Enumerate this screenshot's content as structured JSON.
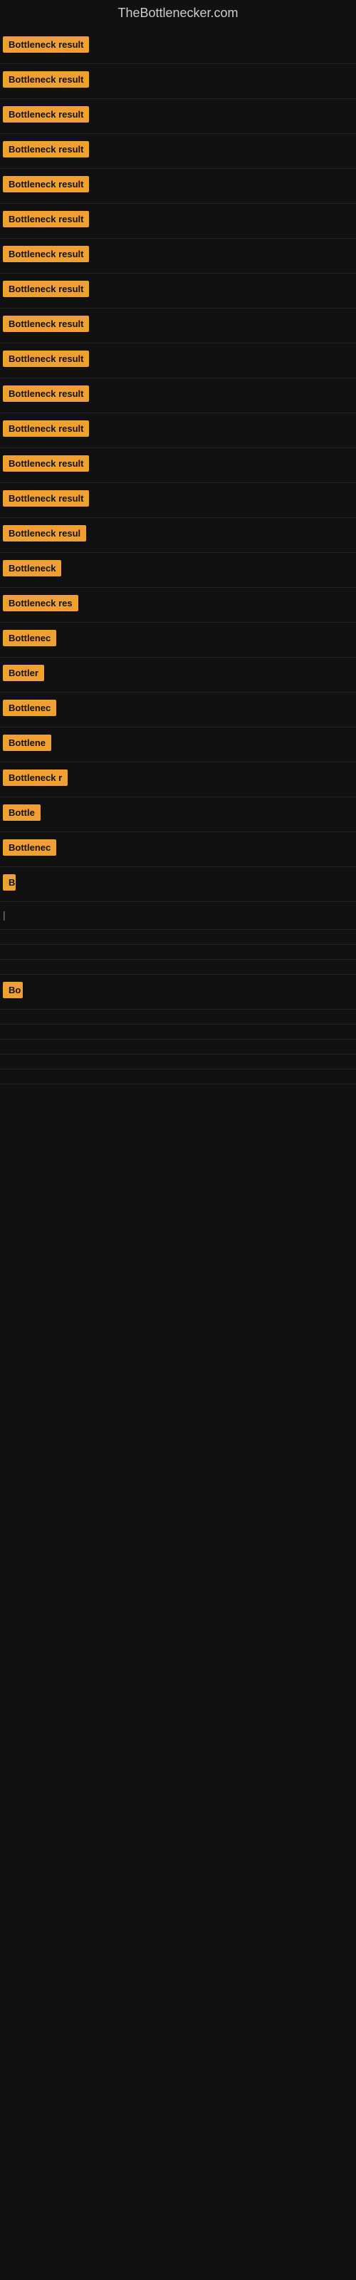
{
  "site": {
    "title": "TheBottlenecker.com"
  },
  "rows": [
    {
      "label": "Bottleneck result",
      "width": 170
    },
    {
      "label": "Bottleneck result",
      "width": 170
    },
    {
      "label": "Bottleneck result",
      "width": 170
    },
    {
      "label": "Bottleneck result",
      "width": 170
    },
    {
      "label": "Bottleneck result",
      "width": 170
    },
    {
      "label": "Bottleneck result",
      "width": 170
    },
    {
      "label": "Bottleneck result",
      "width": 170
    },
    {
      "label": "Bottleneck result",
      "width": 170
    },
    {
      "label": "Bottleneck result",
      "width": 170
    },
    {
      "label": "Bottleneck result",
      "width": 170
    },
    {
      "label": "Bottleneck result",
      "width": 170
    },
    {
      "label": "Bottleneck result",
      "width": 170
    },
    {
      "label": "Bottleneck result",
      "width": 170
    },
    {
      "label": "Bottleneck result",
      "width": 170
    },
    {
      "label": "Bottleneck resul",
      "width": 160
    },
    {
      "label": "Bottleneck",
      "width": 100
    },
    {
      "label": "Bottleneck res",
      "width": 130
    },
    {
      "label": "Bottlenec",
      "width": 90
    },
    {
      "label": "Bottler",
      "width": 65
    },
    {
      "label": "Bottlenec",
      "width": 90
    },
    {
      "label": "Bottlene",
      "width": 80
    },
    {
      "label": "Bottleneck r",
      "width": 110
    },
    {
      "label": "Bottle",
      "width": 60
    },
    {
      "label": "Bottlenec",
      "width": 90
    },
    {
      "label": "B",
      "width": 18
    },
    {
      "label": "|",
      "width": 10
    },
    {
      "label": "",
      "width": 0
    },
    {
      "label": "",
      "width": 0
    },
    {
      "label": "",
      "width": 0
    },
    {
      "label": "Bo",
      "width": 28
    },
    {
      "label": "",
      "width": 0
    },
    {
      "label": "",
      "width": 0
    },
    {
      "label": "",
      "width": 0
    },
    {
      "label": "",
      "width": 0
    },
    {
      "label": "",
      "width": 0
    }
  ]
}
